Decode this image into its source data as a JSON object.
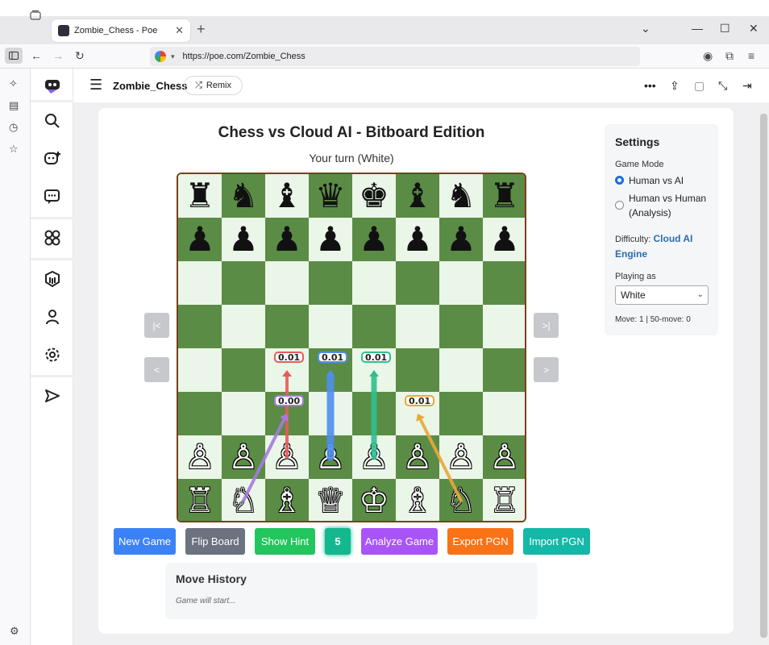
{
  "browser": {
    "tab_title": "Zombie_Chess - Poe",
    "tab_close": "✕",
    "new_tab": "+",
    "url": "https://poe.com/Zombie_Chess"
  },
  "header": {
    "bot_name": "Zombie_Chess",
    "remix_label": "Remix"
  },
  "game": {
    "title": "Chess vs Cloud AI - Bitboard Edition",
    "status": "Your turn (White)",
    "board_rows": [
      [
        "♜",
        "♞",
        "♝",
        "♛",
        "♚",
        "♝",
        "♞",
        "♜"
      ],
      [
        "♟",
        "♟",
        "♟",
        "♟",
        "♟",
        "♟",
        "♟",
        "♟"
      ],
      [
        "",
        "",
        "",
        "",
        "",
        "",
        "",
        ""
      ],
      [
        "",
        "",
        "",
        "",
        "",
        "",
        "",
        ""
      ],
      [
        "",
        "",
        "",
        "",
        "",
        "",
        "",
        ""
      ],
      [
        "",
        "",
        "",
        "",
        "",
        "",
        "",
        ""
      ],
      [
        "♙",
        "♙",
        "♙",
        "♙",
        "♙",
        "♙",
        "♙",
        "♙"
      ],
      [
        "♖",
        "♘",
        "♗",
        "♕",
        "♔",
        "♗",
        "♘",
        "♖"
      ]
    ],
    "hint_arrows": [
      {
        "from": "c2",
        "to": "c4",
        "score": "0.01",
        "color": "#e85a5a"
      },
      {
        "from": "d2",
        "to": "d4",
        "score": "0.01",
        "color": "#4f8ff0"
      },
      {
        "from": "e2",
        "to": "e4",
        "score": "0.01",
        "color": "#2fbf8f"
      },
      {
        "from": "b1",
        "to": "c3",
        "score": "0.00",
        "color": "#a57be0"
      },
      {
        "from": "g1",
        "to": "f3",
        "score": "0.01",
        "color": "#e9a93a"
      }
    ],
    "nav": {
      "first": "|<",
      "prev": "<",
      "last": ">|",
      "next": ">"
    }
  },
  "buttons": {
    "new_game": "New Game",
    "flip_board": "Flip Board",
    "show_hint": "Show Hint",
    "hint_count": "5",
    "analyze": "Analyze Game",
    "export_pgn": "Export PGN",
    "import_pgn": "Import PGN"
  },
  "history": {
    "title": "Move History",
    "placeholder": "Game will start..."
  },
  "settings": {
    "title": "Settings",
    "game_mode_label": "Game Mode",
    "mode_options": [
      "Human vs AI",
      "Human vs Human (Analysis)"
    ],
    "selected_mode": "Human vs AI",
    "difficulty_label": "Difficulty:",
    "difficulty_value": "Cloud AI Engine",
    "playing_as_label": "Playing as",
    "playing_as_value": "White",
    "move_info": "Move: 1 | 50-move: 0"
  },
  "colors": {
    "light_square": "#eaf6e8",
    "dark_square": "#5b8c45",
    "board_border": "#7b3f1a",
    "new_game": "#3b82f6",
    "flip_board": "#6b7280",
    "show_hint": "#22c55e",
    "hint_count": "#14b88f",
    "analyze": "#a855f7",
    "export_pgn": "#f97316",
    "import_pgn": "#14b8a6"
  }
}
